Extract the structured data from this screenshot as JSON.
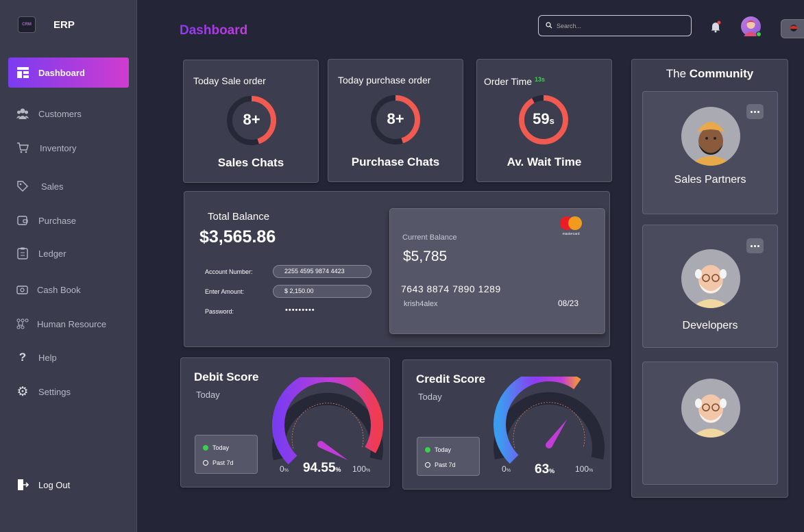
{
  "app": {
    "name": "ERP",
    "logo_text": "CRM"
  },
  "sidebar": {
    "items": [
      {
        "label": "Dashboard",
        "icon": "dashboard-icon"
      },
      {
        "label": "Customers",
        "icon": "users-icon"
      },
      {
        "label": "Inventory",
        "icon": "cart-icon"
      },
      {
        "label": "Sales",
        "icon": "tag-icon"
      },
      {
        "label": "Purchase",
        "icon": "wallet-icon"
      },
      {
        "label": "Ledger",
        "icon": "clipboard-icon"
      },
      {
        "label": "Cash Book",
        "icon": "cash-icon"
      },
      {
        "label": "Human Resource",
        "icon": "org-chart-icon"
      },
      {
        "label": "Help",
        "icon": "question-icon"
      },
      {
        "label": "Settings",
        "icon": "gear-icon"
      }
    ],
    "logout": "Log Out"
  },
  "header": {
    "title": "Dashboard",
    "search_placeholder": "Search..."
  },
  "stats": [
    {
      "label": "Today Sale  order",
      "value": "8+",
      "title": "Sales Chats",
      "progress": 0.45
    },
    {
      "label": "Today purchase order",
      "value": "8+",
      "title": "Purchase Chats",
      "progress": 0.45
    },
    {
      "label": "Order Time",
      "badge": "13s",
      "value": "59",
      "unit": "s",
      "title": "Av. Wait Time",
      "progress": 0.92
    }
  ],
  "balance": {
    "label": "Total Balance",
    "value": "$3,565.86",
    "fields": [
      {
        "label": "Account Number:",
        "value": "2255 4595 9874 4423"
      },
      {
        "label": "Enter Amount:",
        "value": "$ 2,150.00"
      },
      {
        "label": "Password:",
        "value": "•••••••••"
      }
    ],
    "card": {
      "label": "Current Balance",
      "value": "$5,785",
      "number": "7643 8874 7890 1289",
      "holder": "krish4alex",
      "expiry": "08/23",
      "brand": "mastercard"
    }
  },
  "debit": {
    "title": "Debit Score",
    "sub": "Today",
    "legend": [
      "Today",
      "Past 7d"
    ],
    "min": "0",
    "max": "100",
    "unit": "%",
    "value": "94.55",
    "fraction": 0.9455
  },
  "credit": {
    "title": "Credit Score",
    "sub": "Today",
    "legend": [
      "Today",
      "Past 7d"
    ],
    "min": "0",
    "max": "100",
    "unit": "%",
    "value": "63",
    "fraction": 0.63
  },
  "community": {
    "title_prefix": "The",
    "title_bold": "Community",
    "cards": [
      {
        "label": "Sales Partners"
      },
      {
        "label": "Developers"
      },
      {
        "label": ""
      }
    ]
  },
  "colors": {
    "accent": "#8c3cf0",
    "ring": "#f05a50",
    "online": "#39d24a"
  }
}
